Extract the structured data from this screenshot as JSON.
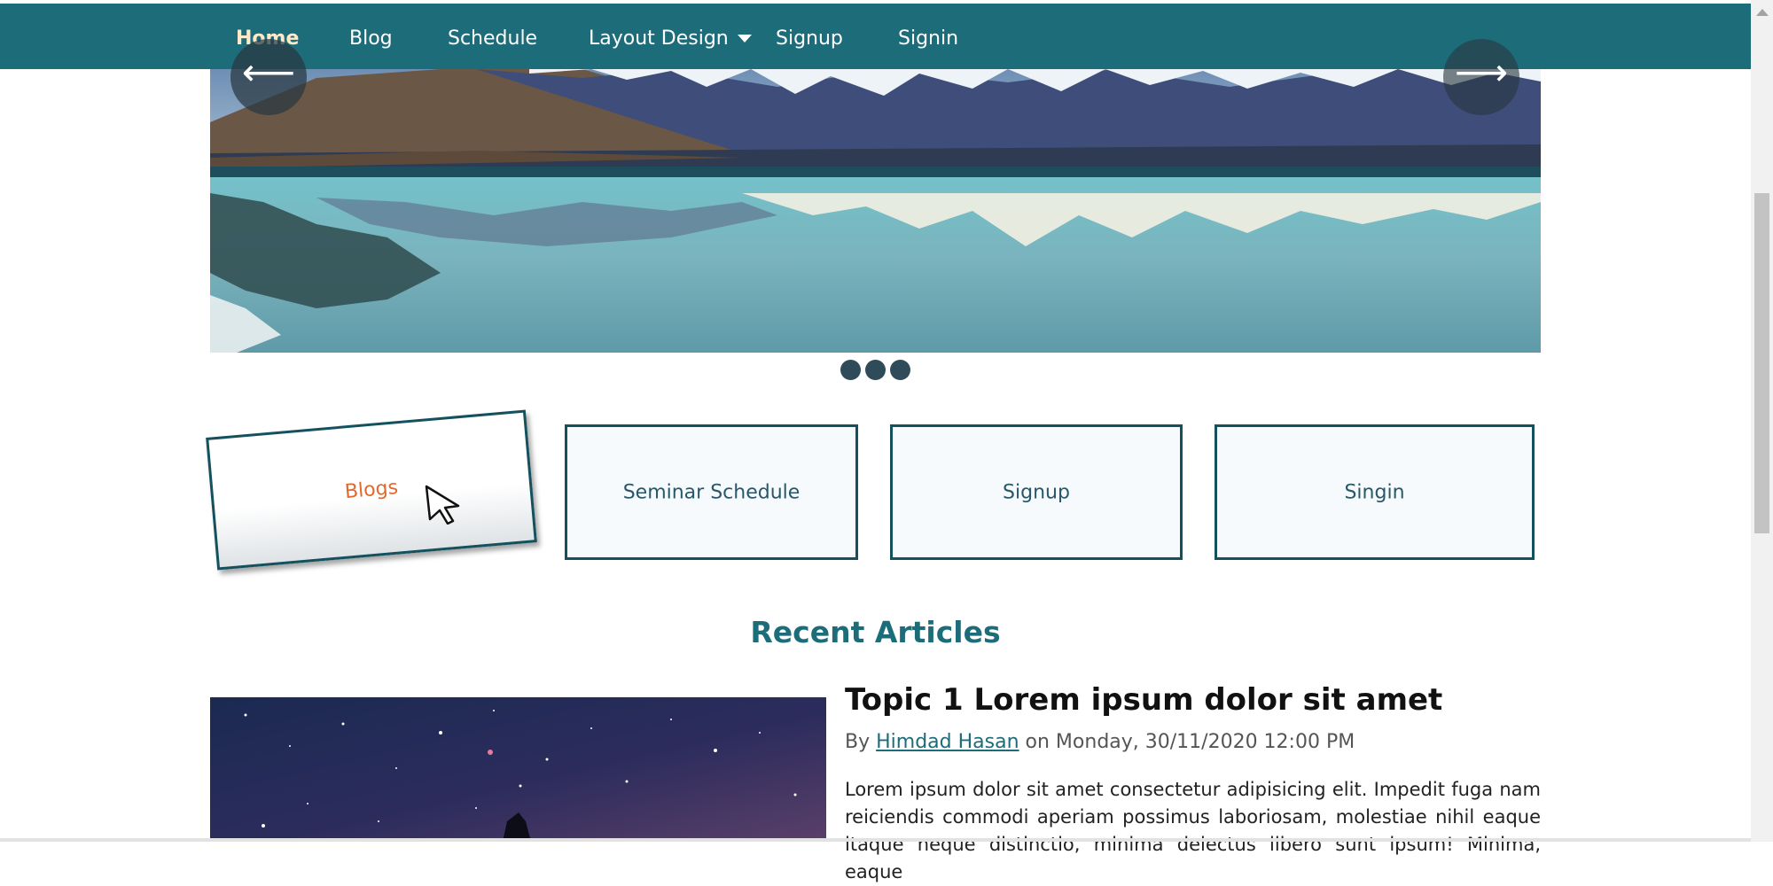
{
  "nav": {
    "items": [
      {
        "label": "Home",
        "active": true
      },
      {
        "label": "Blog"
      },
      {
        "label": "Schedule"
      },
      {
        "label": "Layout Design",
        "dropdown": true
      },
      {
        "label": "Signup"
      },
      {
        "label": "Signin"
      }
    ],
    "accent_color": "#f39c32",
    "bar_color": "#1d6c7a"
  },
  "carousel": {
    "prev_icon": "arrow-left-icon",
    "next_icon": "arrow-right-icon",
    "prev_glyph": "⟵",
    "next_glyph": "⟶",
    "indicator_count": 3
  },
  "cards": [
    {
      "label": "Blogs"
    },
    {
      "label": "Seminar Schedule"
    },
    {
      "label": "Signup"
    },
    {
      "label": "Singin"
    }
  ],
  "articles_section": {
    "title": "Recent Articles",
    "article": {
      "title": "Topic 1 Lorem ipsum dolor sit amet",
      "by_prefix": "By",
      "author": "Himdad Hasan",
      "date_text": "on Monday, 30/11/2020 12:00 PM",
      "body": "Lorem ipsum dolor sit amet consectetur adipisicing elit. Impedit fuga nam reiciendis commodi aperiam possimus laboriosam, molestiae nihil eaque itaque neque distinctio, minima delectus libero sunt ipsum! Minima, eaque"
    }
  }
}
